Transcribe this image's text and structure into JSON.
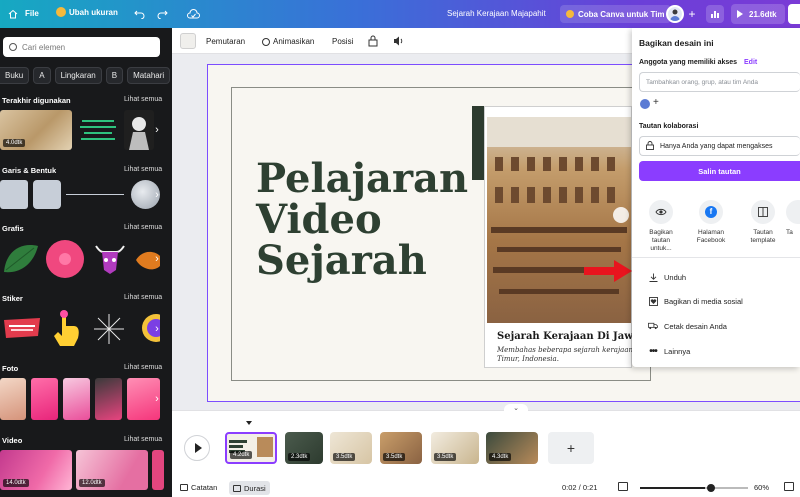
{
  "topbar": {
    "home_label": "",
    "file_label": "File",
    "resize_label": "Ubah ukuran",
    "doc_title": "Sejarah Kerajaan Majapahit",
    "trial_label": "Coba Canva untuk Tim",
    "duration_label": "21.6dtk"
  },
  "left": {
    "search_placeholder": "Cari elemen",
    "chips": [
      "Buku",
      "A",
      "Lingkaran",
      "B",
      "Matahari"
    ],
    "sections": {
      "recent": "Terakhir digunakan",
      "lines": "Garis & Bentuk",
      "graphics": "Grafis",
      "stickers": "Stiker",
      "photos": "Foto",
      "videos": "Video"
    },
    "see_all": "Lihat semua",
    "recent_badge": "4.0dtk",
    "video_badges": [
      "14.0dtk",
      "12.0dtk"
    ]
  },
  "toolbar": {
    "playback": "Pemutaran",
    "animate": "Animasikan",
    "position": "Posisi"
  },
  "canvas": {
    "title_lines": [
      "Pelajaran",
      "Video",
      "Sejarah"
    ],
    "card_title": "Sejarah Kerajaan Di Jawa",
    "card_sub_1": "Membahas beberapa sejarah kerajaan-k",
    "card_sub_2": "Timur, Indonesia."
  },
  "share": {
    "heading": "Bagikan desain ini",
    "members_label": "Anggota yang memiliki akses",
    "edit_label": "Edit",
    "invite_placeholder": "Tambahkan orang, grup, atau tim Anda",
    "collab_label": "Tautan kolaborasi",
    "access_value": "Hanya Anda yang dapat mengakses",
    "copy_button": "Salin tautan",
    "options": [
      {
        "label_1": "Bagikan tautan",
        "label_2": "untuk..."
      },
      {
        "label_1": "Halaman",
        "label_2": "Facebook"
      },
      {
        "label_1": "Tautan",
        "label_2": "template"
      },
      {
        "label_1": "Ta",
        "label_2": ""
      }
    ],
    "items": [
      "Unduh",
      "Bagikan di media sosial",
      "Cetak desain Anda",
      "Lainnya"
    ]
  },
  "timeline": {
    "clips": [
      {
        "badge": "4.2dtk"
      },
      {
        "badge": "2.3dtk"
      },
      {
        "badge": "3.5dtk"
      },
      {
        "badge": "3.5dtk"
      },
      {
        "badge": "3.5dtk"
      },
      {
        "badge": "4.3dtk"
      }
    ]
  },
  "bottom": {
    "notes": "Catatan",
    "duration": "Durasi",
    "time": "0:02 / 0:21",
    "zoom": "60%"
  },
  "colors": {
    "accent": "#8b3dff",
    "title_green": "#2e4032",
    "panel_dark": "#18191b",
    "arrow_red": "#e8141e"
  }
}
